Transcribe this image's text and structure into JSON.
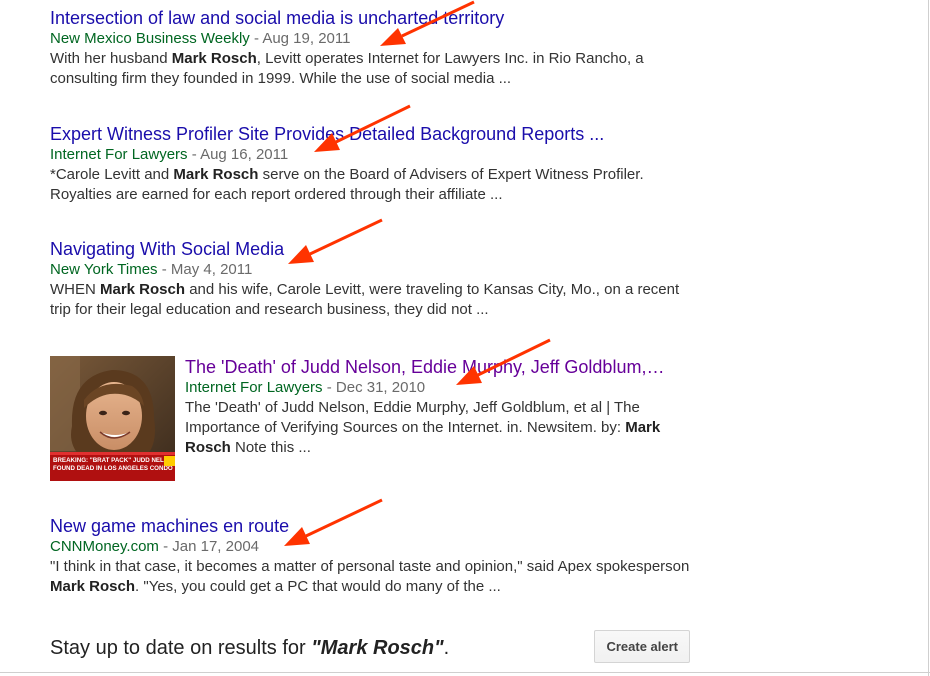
{
  "results": [
    {
      "title": "Intersection of law and social media is uncharted territory",
      "source": "New Mexico Business Weekly",
      "date": "Aug 19, 2011",
      "snippet_parts": [
        {
          "t": "With her husband ",
          "b": false
        },
        {
          "t": "Mark Rosch",
          "b": true
        },
        {
          "t": ", Levitt operates Internet for Lawyers Inc. in Rio Rancho, a consulting firm they founded in 1999. While the use of social media ...",
          "b": false
        }
      ]
    },
    {
      "title": "Expert Witness Profiler Site Provides Detailed Background Reports ...",
      "source": "Internet For Lawyers",
      "date": "Aug 16, 2011",
      "snippet_parts": [
        {
          "t": "*Carole Levitt and ",
          "b": false
        },
        {
          "t": "Mark Rosch",
          "b": true
        },
        {
          "t": " serve on the Board of Advisers of Expert Witness Profiler. Royalties are earned for each report ordered through their affiliate ...",
          "b": false
        }
      ]
    },
    {
      "title": "Navigating With Social Media",
      "source": "New York Times",
      "date": "May 4, 2011",
      "snippet_parts": [
        {
          "t": "WHEN ",
          "b": false
        },
        {
          "t": "Mark Rosch",
          "b": true
        },
        {
          "t": " and his wife, Carole Levitt, were traveling to Kansas City, Mo., on a recent trip for their legal education and research business, they did not ...",
          "b": false
        }
      ]
    },
    {
      "title": "The 'Death' of Judd Nelson, Eddie Murphy, Jeff Goldblum,…",
      "source": "Internet For Lawyers",
      "date": "Dec 31, 2010",
      "thumbnail_caption": "BREAKING: \"BRAT PACK\" JUDD NELSON FOUND DEAD IN LOS ANGELES CONDO",
      "snippet_parts": [
        {
          "t": "The 'Death' of Judd Nelson, Eddie Murphy, Jeff Goldblum, et al | The Importance of Verifying Sources on the Internet. in. Newsitem. by: ",
          "b": false
        },
        {
          "t": "Mark Rosch",
          "b": true
        },
        {
          "t": " Note this ...",
          "b": false
        }
      ]
    },
    {
      "title": "New game machines en route",
      "source": "CNNMoney.com",
      "date": "Jan 17, 2004",
      "snippet_parts": [
        {
          "t": "\"I think in that case, it becomes a matter of personal taste and opinion,\" said Apex spokesperson ",
          "b": false
        },
        {
          "t": "Mark Rosch",
          "b": true
        },
        {
          "t": ". \"Yes, you could get a PC that would do many of the ...",
          "b": false
        }
      ]
    }
  ],
  "alert": {
    "prefix": "Stay up to date on results for ",
    "query": "\"Mark Rosch\"",
    "suffix": ".",
    "button_label": "Create alert"
  },
  "colors": {
    "link": "#1a0dab",
    "visited_link": "#660099",
    "source": "#006621",
    "annotation_arrow": "#ff3300"
  }
}
